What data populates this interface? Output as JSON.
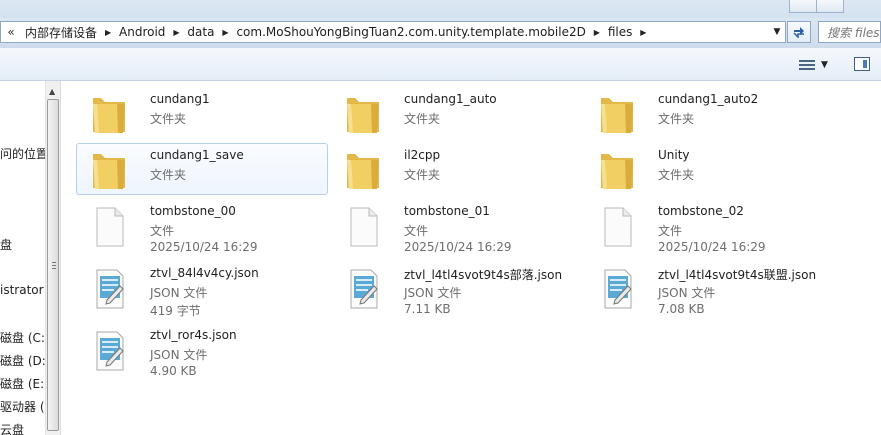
{
  "address": {
    "back_glyph": "«",
    "crumbs": [
      "内部存储设备",
      "Android",
      "data",
      "com.MoShouYongBingTuan2.com.unity.template.mobile2D",
      "files"
    ],
    "search_placeholder": "搜索 files"
  },
  "nav": {
    "items": [
      "问的位置",
      "盘",
      "istrator",
      "磁盘 (C:)",
      "磁盘 (D:)",
      "磁盘 (E:)",
      "驱动器 (F",
      "云盘"
    ]
  },
  "files": [
    {
      "name": "cundang1",
      "type": "文件夹",
      "icon": "folder-icon",
      "selected": false
    },
    {
      "name": "cundang1_auto",
      "type": "文件夹",
      "icon": "folder-icon",
      "selected": false
    },
    {
      "name": "cundang1_auto2",
      "type": "文件夹",
      "icon": "folder-icon",
      "selected": false
    },
    {
      "name": "cundang1_save",
      "type": "文件夹",
      "icon": "folder-icon",
      "selected": true
    },
    {
      "name": "il2cpp",
      "type": "文件夹",
      "icon": "folder-icon",
      "selected": false
    },
    {
      "name": "Unity",
      "type": "文件夹",
      "icon": "folder-icon",
      "selected": false
    },
    {
      "name": "tombstone_00",
      "type": "文件",
      "meta": "2025/10/24 16:29",
      "icon": "blank-file-icon",
      "selected": false
    },
    {
      "name": "tombstone_01",
      "type": "文件",
      "meta": "2025/10/24 16:29",
      "icon": "blank-file-icon",
      "selected": false
    },
    {
      "name": "tombstone_02",
      "type": "文件",
      "meta": "2025/10/24 16:29",
      "icon": "blank-file-icon",
      "selected": false
    },
    {
      "name": "ztvl_84l4v4cy.json",
      "type": "JSON 文件",
      "meta": "419 字节",
      "icon": "json-file-icon",
      "selected": false
    },
    {
      "name": "ztvl_l4tl4svot9t4s部落.json",
      "type": "JSON 文件",
      "meta": "7.11 KB",
      "icon": "json-file-icon",
      "selected": false
    },
    {
      "name": "ztvl_l4tl4svot9t4s联盟.json",
      "type": "JSON 文件",
      "meta": "7.08 KB",
      "icon": "json-file-icon",
      "selected": false
    },
    {
      "name": "ztvl_ror4s.json",
      "type": "JSON 文件",
      "meta": "4.90 KB",
      "icon": "json-file-icon",
      "selected": false
    }
  ],
  "colors": {
    "folder": "#f2cf63",
    "selection_border": "#b6d0ee",
    "secondary_text": "#6d6d6d"
  }
}
